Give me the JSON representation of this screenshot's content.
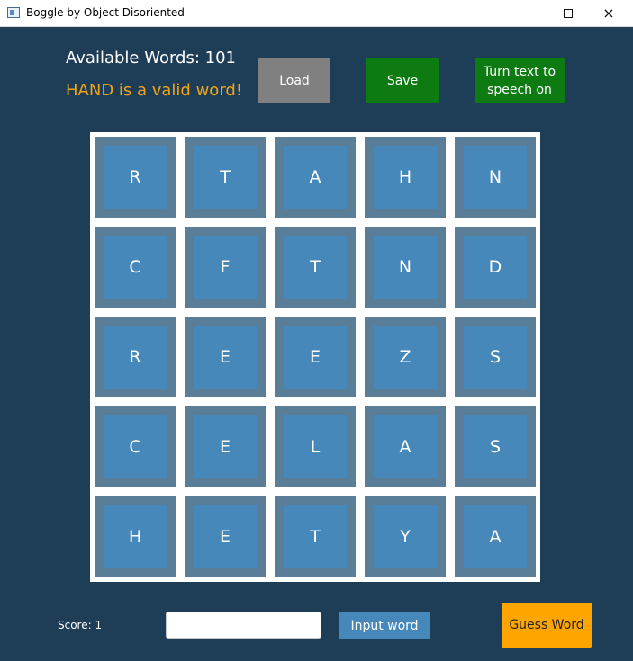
{
  "window": {
    "title": "Boggle by Object Disoriented",
    "controls": {
      "minimize": "minimize-icon",
      "maximize": "maximize-icon",
      "close": "×"
    }
  },
  "header": {
    "available_words": "Available Words: 101",
    "status_message": "HAND is a valid word!",
    "status_color": "#f2a417"
  },
  "toolbar": {
    "load_label": "Load",
    "save_label": "Save",
    "tts_label": "Turn text to speech on"
  },
  "board": {
    "rows": [
      [
        "R",
        "T",
        "A",
        "H",
        "N"
      ],
      [
        "C",
        "F",
        "T",
        "N",
        "D"
      ],
      [
        "R",
        "E",
        "E",
        "Z",
        "S"
      ],
      [
        "C",
        "E",
        "L",
        "A",
        "S"
      ],
      [
        "H",
        "E",
        "T",
        "Y",
        "A"
      ]
    ]
  },
  "footer": {
    "score": "Score: 1",
    "input_value": "",
    "input_word_label": "Input word",
    "guess_word_label": "Guess Word"
  },
  "colors": {
    "background": "#1e3d57",
    "tile": "#4788ba",
    "tile_border": "#5a7d98",
    "save_green": "#0d7b12",
    "load_gray": "#808080",
    "guess_orange": "#ffa500"
  }
}
